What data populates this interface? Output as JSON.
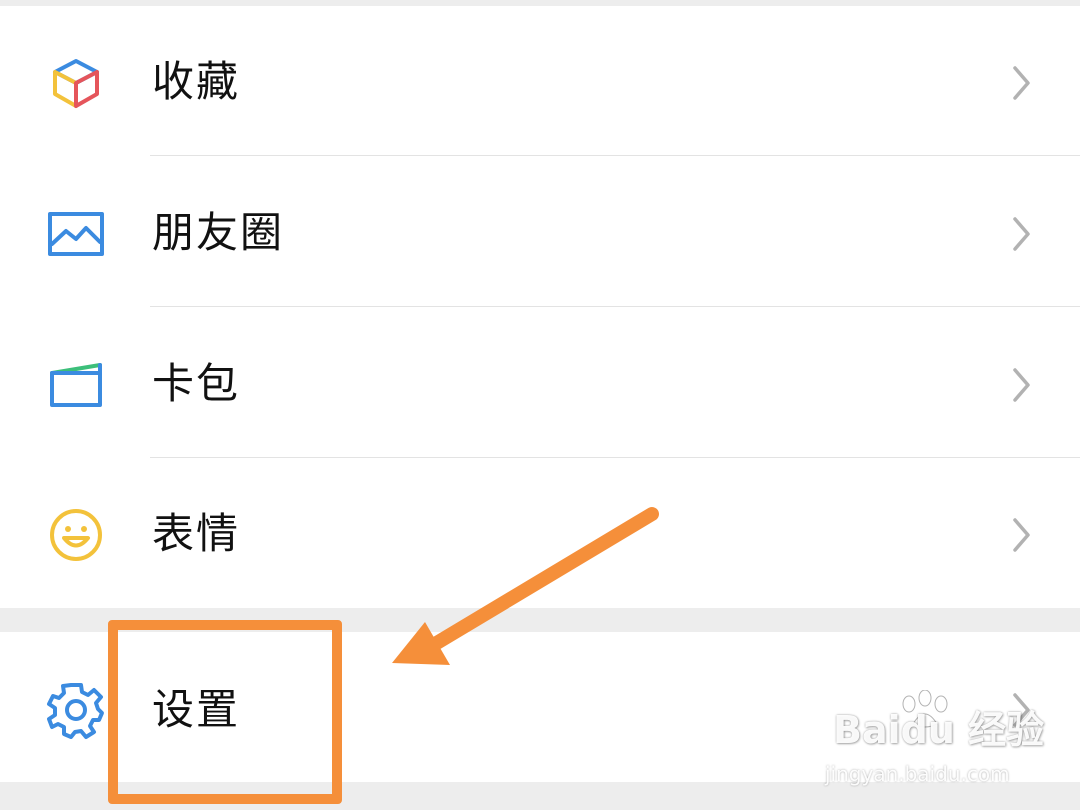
{
  "menu": {
    "items": [
      {
        "label": "收藏",
        "icon": "favorites-cube-icon"
      },
      {
        "label": "朋友圈",
        "icon": "moments-picture-icon"
      },
      {
        "label": "卡包",
        "icon": "card-wallet-icon"
      },
      {
        "label": "表情",
        "icon": "sticker-smiley-icon"
      }
    ],
    "settings": {
      "label": "设置",
      "icon": "gear-icon"
    }
  },
  "annotation": {
    "color": "#f58f3a"
  },
  "watermark": {
    "brand": "Baidu 经验",
    "url": "jingyan.baidu.com"
  },
  "colors": {
    "background": "#ededed",
    "row": "#ffffff",
    "chevron": "#b2b2b2",
    "text": "#111111"
  }
}
